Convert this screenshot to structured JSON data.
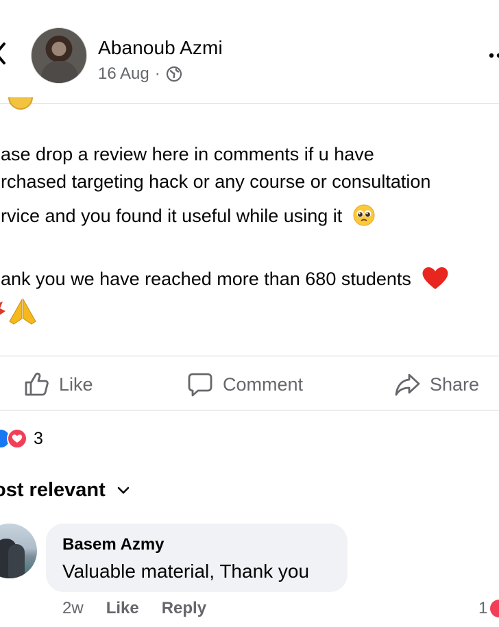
{
  "header": {
    "author": "Abanoub Azmi",
    "date": "16 Aug",
    "separator": "·"
  },
  "post": {
    "lines": [
      "ease drop a review here in comments if u have",
      "urchased targeting hack or any course or consultation",
      "ervice and you found it useful while using it",
      "",
      "hank you we have reached more than 680 students"
    ]
  },
  "actions": {
    "like": "Like",
    "comment": "Comment",
    "share": "Share"
  },
  "reactions": {
    "count": "3"
  },
  "comments_sort": {
    "label": "ost relevant"
  },
  "comments": [
    {
      "author": "Basem Azmy",
      "text": "Valuable material, Thank you",
      "time": "2w",
      "like": "Like",
      "reply": "Reply",
      "reaction_count": "1"
    }
  ],
  "colors": {
    "secondary_text": "#65676b",
    "like_blue": "#1877f2",
    "love_red": "#f33e58",
    "bubble_bg": "#f0f2f5"
  }
}
